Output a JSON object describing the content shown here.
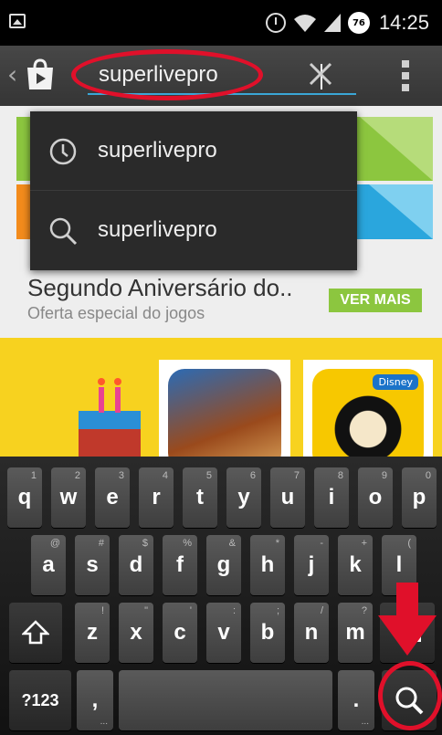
{
  "status_bar": {
    "time": "14:25",
    "battery_level": "76",
    "icons": [
      "image-notification-icon",
      "alarm-icon",
      "wifi-icon",
      "signal-icon",
      "battery-icon"
    ]
  },
  "action_bar": {
    "search_query": "superlivepro",
    "icons": [
      "back-chevron-icon",
      "play-store-icon",
      "clear-icon",
      "overflow-menu-icon"
    ]
  },
  "suggestions": [
    {
      "type": "history",
      "icon": "clock-history-icon",
      "text": "superlivepro"
    },
    {
      "type": "search",
      "icon": "search-icon",
      "text": "superlivepro"
    }
  ],
  "promo": {
    "title": "Segundo Aniversário do..",
    "subtitle": "Oferta especial do jogos",
    "button": "VER MAIS",
    "badge": "Disney"
  },
  "keyboard": {
    "row1": [
      {
        "label": "q",
        "hint": "1"
      },
      {
        "label": "w",
        "hint": "2"
      },
      {
        "label": "e",
        "hint": "3"
      },
      {
        "label": "r",
        "hint": "4"
      },
      {
        "label": "t",
        "hint": "5"
      },
      {
        "label": "y",
        "hint": "6"
      },
      {
        "label": "u",
        "hint": "7"
      },
      {
        "label": "i",
        "hint": "8"
      },
      {
        "label": "o",
        "hint": "9"
      },
      {
        "label": "p",
        "hint": "0"
      }
    ],
    "row2": [
      {
        "label": "a",
        "hint": "@"
      },
      {
        "label": "s",
        "hint": "#"
      },
      {
        "label": "d",
        "hint": "$"
      },
      {
        "label": "f",
        "hint": "%"
      },
      {
        "label": "g",
        "hint": "&"
      },
      {
        "label": "h",
        "hint": "*"
      },
      {
        "label": "j",
        "hint": "-"
      },
      {
        "label": "k",
        "hint": "+"
      },
      {
        "label": "l",
        "hint": "("
      }
    ],
    "row3": [
      {
        "label": "z",
        "hint": "!"
      },
      {
        "label": "x",
        "hint": "\""
      },
      {
        "label": "c",
        "hint": "'"
      },
      {
        "label": "v",
        "hint": ":"
      },
      {
        "label": "b",
        "hint": ";"
      },
      {
        "label": "n",
        "hint": "/"
      },
      {
        "label": "m",
        "hint": "?"
      }
    ],
    "symbols_label": "?123",
    "comma": ",",
    "period": ".",
    "more_dots": "..."
  },
  "colors": {
    "accent_blue": "#3aa6d6",
    "annotation_red": "#e0102a",
    "promo_green": "#8cc63f"
  }
}
